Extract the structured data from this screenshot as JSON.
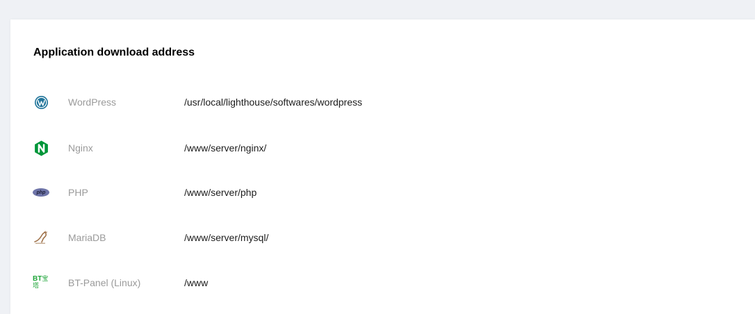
{
  "section": {
    "title": "Application download address"
  },
  "apps": [
    {
      "name": "WordPress",
      "path": "/usr/local/lighthouse/softwares/wordpress",
      "icon": "wordpress-icon"
    },
    {
      "name": "Nginx",
      "path": "/www/server/nginx/",
      "icon": "nginx-icon"
    },
    {
      "name": "PHP",
      "path": "/www/server/php",
      "icon": "php-icon",
      "icon_text": "php"
    },
    {
      "name": "MariaDB",
      "path": "/www/server/mysql/",
      "icon": "mariadb-icon"
    },
    {
      "name": "BT-Panel (Linux)",
      "path": "/www",
      "icon": "bt-panel-icon",
      "icon_text": "BT",
      "icon_text_cn": "宝塔"
    }
  ],
  "colors": {
    "background": "#eff1f5",
    "card": "#ffffff",
    "name_text": "#9a9a9a",
    "path_text": "#1c1c1c",
    "wordpress": "#21759b",
    "nginx": "#009639",
    "php": "#6e74a8",
    "mariadb": "#a0734b",
    "bt_panel": "#20a53a"
  }
}
